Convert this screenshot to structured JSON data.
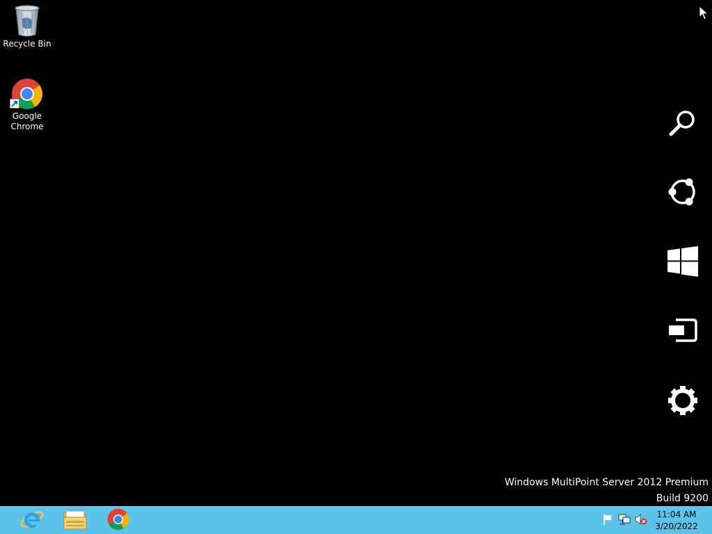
{
  "desktop": {
    "icons": [
      {
        "label": "Recycle Bin",
        "icon": "recycle-bin-icon"
      },
      {
        "label": "Google\nChrome",
        "icon": "chrome-icon"
      }
    ]
  },
  "charms": [
    {
      "name": "Search",
      "icon": "search-icon"
    },
    {
      "name": "Share",
      "icon": "share-icon"
    },
    {
      "name": "Start",
      "icon": "windows-logo-icon"
    },
    {
      "name": "Devices",
      "icon": "devices-icon"
    },
    {
      "name": "Settings",
      "icon": "gear-icon"
    }
  ],
  "watermark": {
    "line1": "Windows MultiPoint Server 2012 Premium",
    "line2": "Build 9200"
  },
  "taskbar": {
    "pinned": [
      {
        "name": "Internet Explorer",
        "icon": "internet-explorer-icon"
      },
      {
        "name": "File Explorer",
        "icon": "file-explorer-icon"
      },
      {
        "name": "Google Chrome",
        "icon": "chrome-icon"
      }
    ],
    "tray": [
      {
        "name": "Action Center",
        "icon": "flag-icon"
      },
      {
        "name": "Network",
        "icon": "network-icon"
      },
      {
        "name": "Volume muted",
        "icon": "speaker-muted-icon"
      }
    ],
    "clock": {
      "time": "11:04 AM",
      "date": "3/20/2022"
    }
  },
  "colors": {
    "desktop_bg": "#000000",
    "taskbar_bg": "#5cc3ea",
    "text_light": "#ffffff"
  }
}
